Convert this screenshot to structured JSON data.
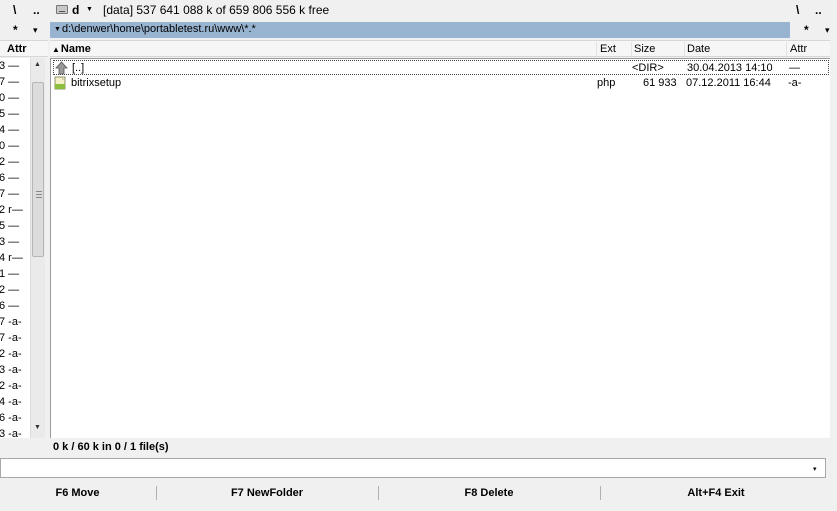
{
  "left_panel": {
    "toolbar_buttons": [
      "\\",
      ".."
    ],
    "filter_buttons": [
      "*",
      "▾"
    ],
    "header_attr": "Attr",
    "rows": [
      "3 —",
      "7 —",
      "0 —",
      "5 —",
      "4 —",
      "0 —",
      "2 —",
      "6 —",
      "7 —",
      "2 r—",
      "5 —",
      "3 —",
      "4 r—",
      "1 —",
      "2 —",
      "6 —",
      "7 -a-",
      "7 -a-",
      "2 -a-",
      "3 -a-",
      "2 -a-",
      "4 -a-",
      "6 -a-",
      "3 -a-"
    ]
  },
  "right_panel": {
    "drive": {
      "letter": "d",
      "info": "[data]  537 641 088 k of 659 806 556 k free",
      "root_button": "\\",
      "up_button": ".."
    },
    "path": "d:\\denwer\\home\\portabletest.ru\\www\\*.*",
    "filter_buttons": [
      "*",
      "▾"
    ],
    "columns": {
      "name": "Name",
      "ext": "Ext",
      "size": "Size",
      "date": "Date",
      "attr": "Attr"
    },
    "files": [
      {
        "name": "[..]",
        "ext": "",
        "size": "<DIR>",
        "date": "30.04.2013 14:10",
        "attr": "—",
        "icon": "up-folder-icon"
      },
      {
        "name": "bitrixsetup",
        "ext": "php",
        "size": "61 933",
        "date": "07.12.2011 16:44",
        "attr": "-a-",
        "icon": "php-file-icon"
      }
    ],
    "status": "0 k / 60 k in 0 / 1 file(s)"
  },
  "command_line": {
    "value": "",
    "dropdown": "▾"
  },
  "function_keys": [
    {
      "label": "F6 Move"
    },
    {
      "label": "F7 NewFolder"
    },
    {
      "label": "F8 Delete"
    },
    {
      "label": "Alt+F4 Exit"
    }
  ],
  "colors": {
    "path_bar": "#99b4d1",
    "background": "#f0f0f0",
    "list_background": "#ffffff"
  }
}
